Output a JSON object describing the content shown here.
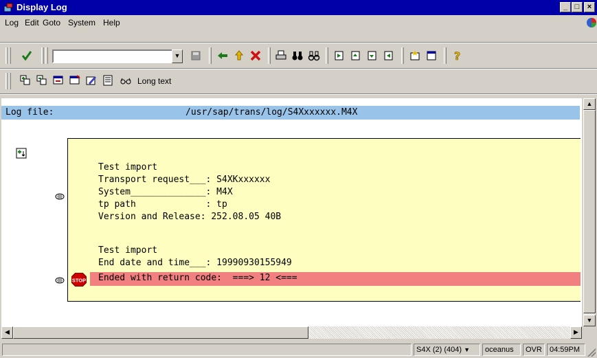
{
  "window": {
    "title": "Display Log"
  },
  "menu": [
    {
      "label": "Log"
    },
    {
      "label": "Edit"
    },
    {
      "label": "Goto"
    },
    {
      "label": "System"
    },
    {
      "label": "Help"
    }
  ],
  "command_field": {
    "value": ""
  },
  "app_toolbar": {
    "long_text_label": "Long text"
  },
  "log": {
    "file_label": "Log file:",
    "file_path": "/usr/sap/trans/log/S4Xxxxxxx.M4X",
    "block1": [
      "Test import",
      "Transport request___: S4XKxxxxxx",
      "System______________: M4X",
      "tp path             : tp",
      "Version and Release: 252.08.05 40B"
    ],
    "block2": [
      "Test import",
      "End date and time___: 19990930155949"
    ],
    "error_line": "Ended with return code:  ===> 12 <===",
    "stop_icon_text": "STOP"
  },
  "status": {
    "system": "S4X (2) (404)",
    "server": "oceanus",
    "mode": "OVR",
    "time": "04:59PM"
  },
  "colors": {
    "title_bar": "#0000a8",
    "log_header": "#99c3e8",
    "log_box": "#fefec0",
    "error_row": "#f28080",
    "stop_red": "#cc0000"
  }
}
